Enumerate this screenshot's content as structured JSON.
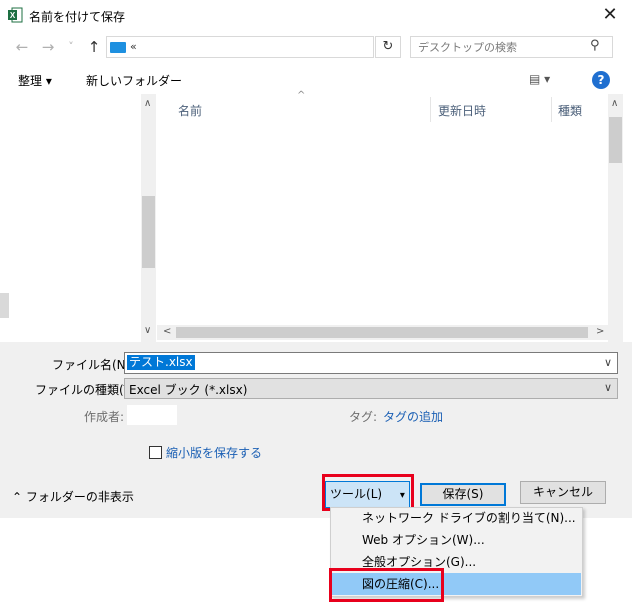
{
  "window": {
    "title": "名前を付けて保存",
    "close_icon": "close-icon"
  },
  "nav": {
    "back_icon": "←",
    "forward_icon": "→",
    "recent_icon": "˅",
    "up_icon": "↑",
    "address_text": "«",
    "refresh_icon": "↻",
    "search_placeholder": "デスクトップの検索",
    "search_icon": "⚲"
  },
  "toolbar": {
    "organize": "整理 ▾",
    "new_folder": "新しいフォルダー",
    "view_icon": "▤ ▾",
    "help": "?"
  },
  "file_list": {
    "columns": [
      "名前",
      "更新日時",
      "種類"
    ],
    "sort_indicator": "^"
  },
  "form": {
    "filename_label": "ファイル名(N):",
    "filename_value": "テスト.xlsx",
    "filetype_label": "ファイルの種類(T):",
    "filetype_value": "Excel ブック (*.xlsx)",
    "author_label": "作成者:",
    "tags_label": "タグ:",
    "tags_value": "タグの追加",
    "thumbnail_label": "縮小版を保存する",
    "dropdown_icon": "∨"
  },
  "footer": {
    "hide_folders": "フォルダーの非表示",
    "tools_label": "ツール(L)",
    "tools_arrow": "▾",
    "save_label": "保存(S)",
    "cancel_label": "キャンセル"
  },
  "tools_menu": {
    "items": [
      "ネットワーク ドライブの割り当て(N)...",
      "Web オプション(W)...",
      "全般オプション(G)...",
      "図の圧縮(C)..."
    ]
  }
}
